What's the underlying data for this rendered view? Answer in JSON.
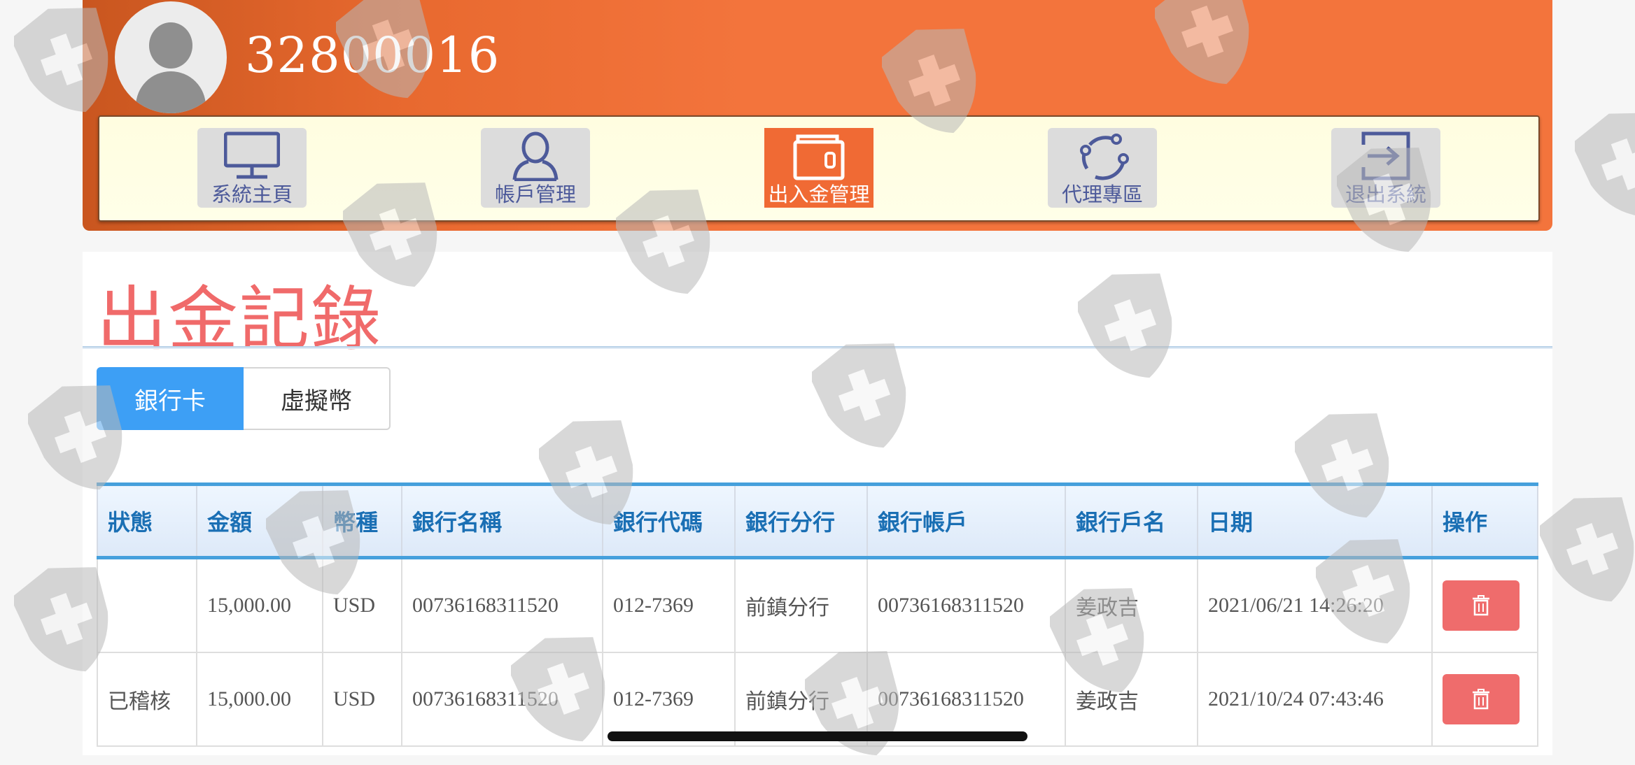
{
  "header": {
    "user_id": "32800016"
  },
  "nav": {
    "items": [
      {
        "label": "系統主頁",
        "icon": "monitor-icon",
        "active": false
      },
      {
        "label": "帳戶管理",
        "icon": "user-icon",
        "active": false
      },
      {
        "label": "出入金管理",
        "icon": "wallet-icon",
        "active": true
      },
      {
        "label": "代理專區",
        "icon": "share-network-icon",
        "active": false
      },
      {
        "label": "退出系統",
        "icon": "logout-icon",
        "active": false
      }
    ]
  },
  "page": {
    "title": "出金記錄"
  },
  "tabs": [
    {
      "label": "銀行卡",
      "active": true
    },
    {
      "label": "虛擬幣",
      "active": false
    }
  ],
  "table": {
    "columns": [
      "狀態",
      "金額",
      "幣種",
      "銀行名稱",
      "銀行代碼",
      "銀行分行",
      "銀行帳戶",
      "銀行戶名",
      "日期",
      "操作"
    ],
    "rows": [
      {
        "status": "",
        "amount": "15,000.00",
        "currency": "USD",
        "bank_name": "00736168311520",
        "bank_code": "012-7369",
        "branch": "前鎮分行",
        "account": "00736168311520",
        "holder": "姜政吉",
        "date": "2021/06/21 14:26:20",
        "action_icon": "trash-icon"
      },
      {
        "status": "已稽核",
        "amount": "15,000.00",
        "currency": "USD",
        "bank_name": "00736168311520",
        "bank_code": "012-7369",
        "branch": "前鎮分行",
        "account": "00736168311520",
        "holder": "姜政吉",
        "date": "2021/10/24 07:43:46",
        "action_icon": "trash-icon"
      }
    ]
  },
  "colors": {
    "header_orange": "#f3743c",
    "title_red": "#f06a6a",
    "tab_blue": "#3d9ff5",
    "table_header_text": "#1a6fb4",
    "delete_red": "#ef6c6c",
    "nav_text": "#4d5a9a"
  },
  "watermark_icon": "shield-cross-icon"
}
